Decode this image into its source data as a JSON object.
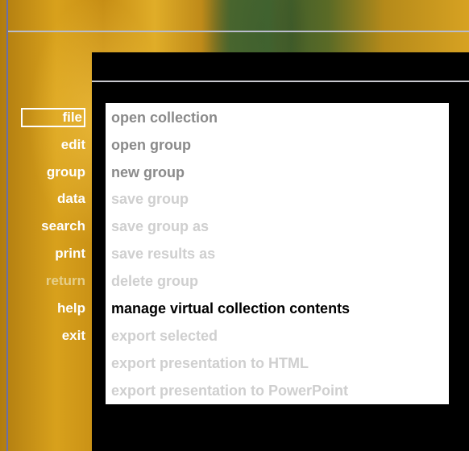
{
  "nav": {
    "items": [
      {
        "label": "file",
        "state": "selected"
      },
      {
        "label": "edit",
        "state": "enabled"
      },
      {
        "label": "group",
        "state": "enabled"
      },
      {
        "label": "data",
        "state": "enabled"
      },
      {
        "label": "search",
        "state": "enabled"
      },
      {
        "label": "print",
        "state": "enabled"
      },
      {
        "label": "return",
        "state": "disabled"
      },
      {
        "label": "help",
        "state": "enabled"
      },
      {
        "label": "exit",
        "state": "enabled"
      }
    ]
  },
  "file_menu": {
    "items": [
      {
        "label": "open collection",
        "state": "enabled"
      },
      {
        "label": "open group",
        "state": "enabled"
      },
      {
        "label": "new group",
        "state": "enabled"
      },
      {
        "label": "save group",
        "state": "disabled"
      },
      {
        "label": "save group as",
        "state": "disabled"
      },
      {
        "label": "save results as",
        "state": "disabled"
      },
      {
        "label": "delete group",
        "state": "disabled"
      },
      {
        "label": "manage virtual collection contents",
        "state": "highlighted"
      },
      {
        "label": "export selected",
        "state": "disabled"
      },
      {
        "label": "export presentation to HTML",
        "state": "disabled"
      },
      {
        "label": "export presentation to PowerPoint",
        "state": "disabled"
      }
    ]
  },
  "colors": {
    "background_gold": "#d8a11c",
    "panel": "#000000",
    "menu_bg": "#ffffff",
    "item_enabled": "#8a8a8a",
    "item_disabled": "#cfcfcf",
    "item_highlighted": "#000000"
  }
}
